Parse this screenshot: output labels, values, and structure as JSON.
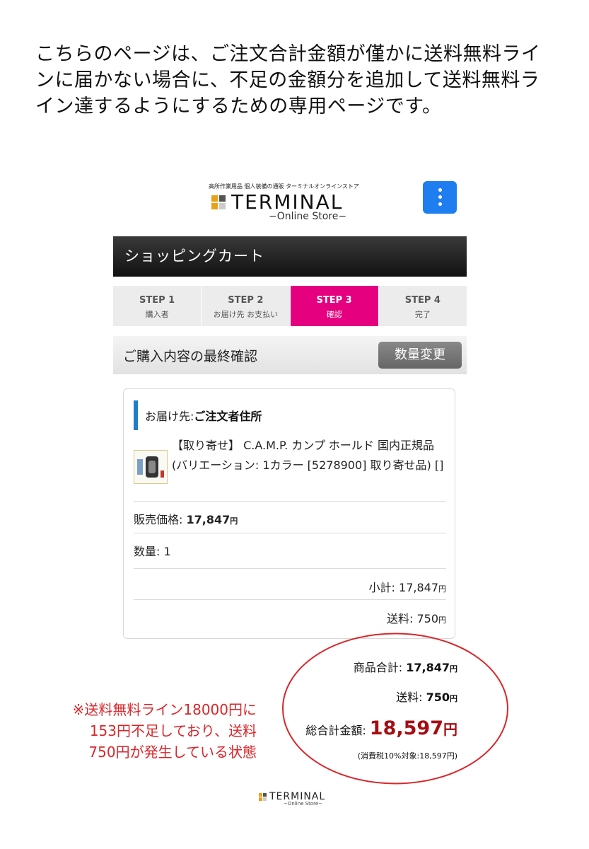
{
  "intro": {
    "line1": "こちらのページは、ご注文合計金額が僅かに送料無料ライ",
    "line2": "ンに届かない場合に、不足の金額分を追加して送料無料ラ",
    "line3": "イン達するようにするための専用ページです。"
  },
  "header": {
    "tagline": "高所作業用品 個人装備の通販 ターミナルオンラインストア",
    "logo_word": "TERMINAL",
    "logo_sub": "−Online Store−",
    "menu_icon": "kebab-menu-icon"
  },
  "cart": {
    "title": "ショッピングカート",
    "steps": [
      {
        "num": "STEP 1",
        "label": "購入者"
      },
      {
        "num": "STEP 2",
        "label": "お届け先 お支払い"
      },
      {
        "num": "STEP 3",
        "label": "確認"
      },
      {
        "num": "STEP 4",
        "label": "完了"
      }
    ],
    "active_step_color": "#e5007f",
    "confirm_title": "ご購入内容の最終確認",
    "qty_button": "数量変更"
  },
  "order": {
    "ship_label": "お届け先: ",
    "ship_value": "ご注文者住所",
    "product_name": "【取り寄せ】 C.A.M.P. カンプ ホールド 国内正規品 (バリエーション: 1カラー [5278900] 取り寄せ品) []",
    "price_label": "販売価格: ",
    "price_value": "17,847",
    "yen": "円",
    "qty_label": "数量: ",
    "qty_value": "1",
    "subtotal_label": "小計: ",
    "subtotal_value": "17,847",
    "shipping_label": "送料: ",
    "shipping_value": "750"
  },
  "totals": {
    "goods_label": "商品合計: ",
    "goods_value": "17,847",
    "ship_label": "送料: ",
    "ship_value": "750",
    "grand_label": "総合計金額: ",
    "grand_value": "18,597",
    "grand_color": "#a50d12",
    "tax_note": "(消費税10%対象:18,597円)"
  },
  "annotation": {
    "line1": "※送料無料ライン18000円に",
    "line2": "153円不足しており、送料",
    "line3": "750円が発生している状態",
    "color": "#d9262a"
  },
  "footer": {
    "logo_word": "TERMINAL",
    "logo_sub": "−Online Store−"
  }
}
